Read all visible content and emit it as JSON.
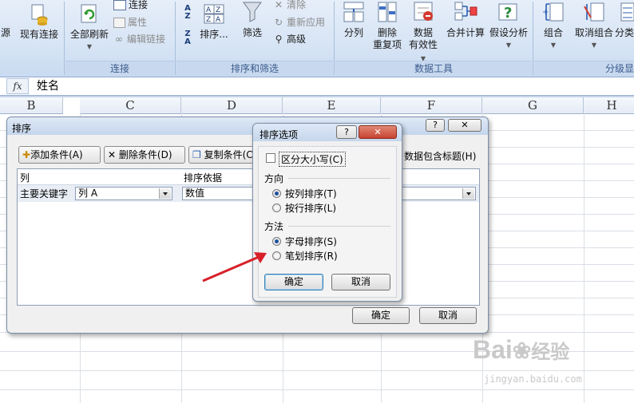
{
  "ribbon": {
    "btn_source_partial": "源",
    "btn_existing_connections": "现有连接",
    "btn_refresh_all": "全部刷新",
    "btn_connections": "连接",
    "btn_properties": "属性",
    "btn_edit_links": "编辑链接",
    "group_connections": "连接",
    "btn_sort": "排序...",
    "btn_filter": "筛选",
    "btn_clear": "清除",
    "btn_reapply": "重新应用",
    "btn_advanced": "高级",
    "group_sort_filter": "排序和筛选",
    "btn_text_to_columns": "分列",
    "btn_remove_duplicates_1": "删除",
    "btn_remove_duplicates_2": "重复项",
    "btn_data_validation_1": "数据",
    "btn_data_validation_2": "有效性",
    "btn_consolidate": "合并计算",
    "btn_what_if": "假设分析",
    "group_data_tools": "数据工具",
    "btn_group": "组合",
    "btn_ungroup": "取消组合",
    "btn_subtotal_partial": "分类",
    "group_outline_partial": "分级显"
  },
  "formula_bar": {
    "fx": "fx",
    "value": "姓名"
  },
  "columns": [
    "B",
    "C",
    "D",
    "E",
    "F",
    "G",
    "H"
  ],
  "sort_dialog": {
    "title": "排序",
    "add_level": "添加条件(A)",
    "delete_level": "删除条件(D)",
    "copy_level": "复制条件(C)",
    "header_checkbox_label": "数据包含标题(H)",
    "col_header_column": "列",
    "col_header_sort_on": "排序依据",
    "row_label": "主要关键字",
    "row_column_value": "列 A",
    "row_sort_on_value": "数值",
    "ok": "确定",
    "cancel": "取消"
  },
  "options_dialog": {
    "title": "排序选项",
    "case_sensitive": "区分大小写(C)",
    "orientation_heading": "方向",
    "sort_top_to_bottom": "按列排序(T)",
    "sort_left_to_right": "按行排序(L)",
    "method_heading": "方法",
    "letter_sort": "字母排序(S)",
    "stroke_sort": "笔划排序(R)",
    "ok": "确定",
    "cancel": "取消"
  },
  "watermark": {
    "brand": "Bai",
    "brand2": "经验",
    "url": "jingyan.baidu.com"
  },
  "colors": {
    "arrow": "#d8202a",
    "ribbon_bg": "#d8e5f5",
    "accent": "#1d4f9c"
  }
}
